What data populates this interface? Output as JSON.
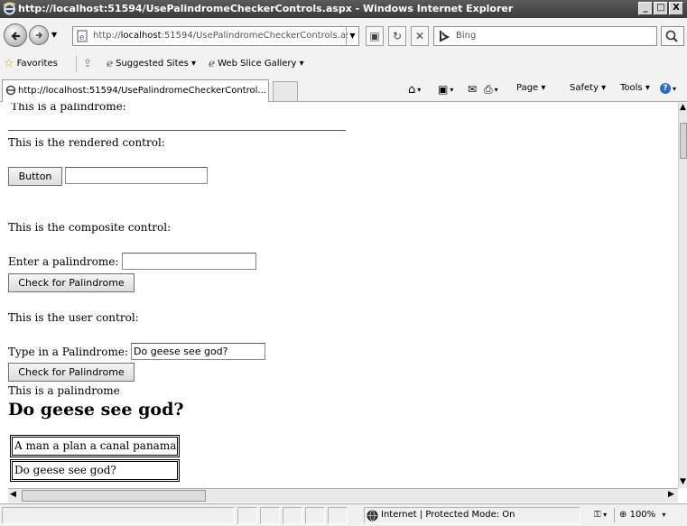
{
  "window": {
    "title": "http://localhost:51594/UsePalindromeCheckerControls.aspx - Windows Internet Explorer",
    "minimize": "_",
    "maximize": "□",
    "close": "X"
  },
  "address_bar": {
    "url_prefix": "http://",
    "url_host": "localhost",
    "url_rest": ":51594/UsePalindromeCheckerControls.aspx",
    "search_placeholder": "Bing"
  },
  "favorites_bar": {
    "favorites_label": "Favorites",
    "suggested_sites_label": "Suggested Sites ▾",
    "web_slice_gallery_label": "Web Slice Gallery ▾"
  },
  "tabs": [
    {
      "label": "http://localhost:51594/UsePalindromeCheckerControl..."
    }
  ],
  "command_bar": {
    "page_label": "Page ▾",
    "safety_label": "Safety ▾",
    "tools_label": "Tools ▾"
  },
  "page": {
    "top_line": "This is a palindrome:",
    "rendered_heading": "This is the rendered control:",
    "rendered_button": "Button",
    "rendered_input_value": "",
    "composite_heading": "This is the composite control:",
    "composite_prompt": "Enter a palindrome:",
    "composite_input_value": "",
    "composite_button": "Check for Palindrome",
    "user_heading": "This is the user control:",
    "user_prompt": "Type in a Palindrome:",
    "user_input_value": "Do geese see god?",
    "user_button": "Check for Palindrome",
    "result_text": "This is a palindrome",
    "result_heading": "Do geese see god?",
    "table_rows": [
      "A man a plan a canal panama",
      "Do geese see god?"
    ]
  },
  "status_bar": {
    "zone_text": "Internet | Protected Mode: On",
    "zoom": "100%"
  }
}
